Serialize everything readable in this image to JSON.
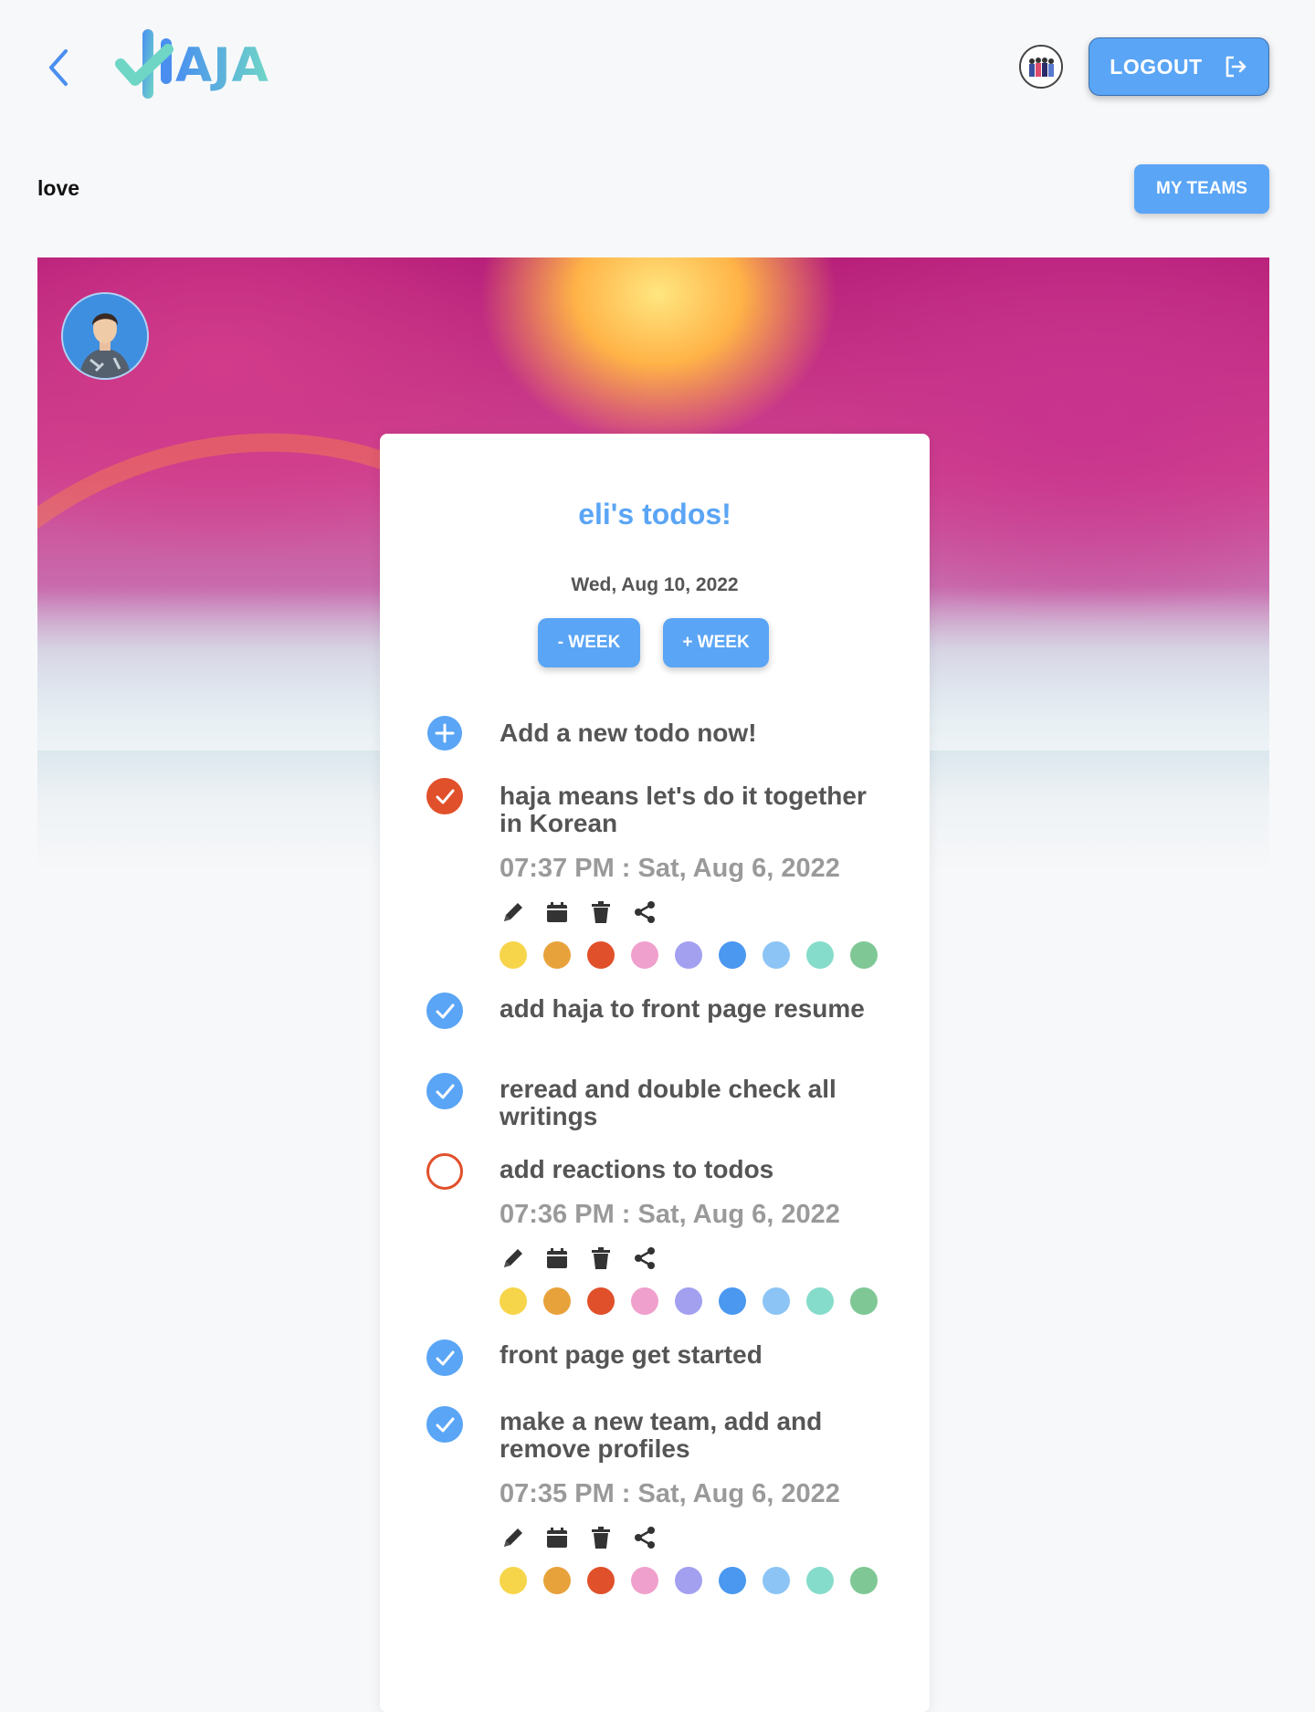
{
  "header": {
    "logo_text": "AJA",
    "logout_label": "LOGOUT",
    "my_teams_label": "MY TEAMS"
  },
  "page": {
    "title": "love"
  },
  "card": {
    "title": "eli's todos!",
    "date": "Wed, Aug 10, 2022",
    "minus_week": "- WEEK",
    "plus_week": "+ WEEK",
    "add_todo": "Add a new todo now!"
  },
  "todos": [
    {
      "text": "haja means let's do it together in Korean",
      "status": "checked-expanded",
      "color": "#e0502a",
      "time": "07:37 PM : Sat, Aug 6, 2022"
    },
    {
      "text": "add haja to front page resume",
      "status": "checked",
      "color": "#5aa5f5"
    },
    {
      "text": "reread and double check all writings",
      "status": "checked",
      "color": "#5aa5f5"
    },
    {
      "text": "add reactions to todos",
      "status": "unchecked-expanded",
      "color": "#e0502a",
      "time": "07:36 PM : Sat, Aug 6, 2022"
    },
    {
      "text": "front page get started",
      "status": "checked",
      "color": "#5aa5f5"
    },
    {
      "text": "make a new team, add and remove profiles",
      "status": "checked-expanded",
      "color": "#5aa5f5",
      "time": "07:35 PM : Sat, Aug 6, 2022"
    }
  ],
  "actions": [
    "pencil-icon",
    "calendar-icon",
    "trash-icon",
    "share-icon"
  ],
  "palette": [
    "#f7d54a",
    "#e8a23c",
    "#e0502a",
    "#f0a0cc",
    "#a3a0f0",
    "#4a98f0",
    "#8cc4f5",
    "#86dccb",
    "#7fc896"
  ],
  "colors": {
    "accent": "#5aa5f5",
    "danger": "#e0502a"
  }
}
